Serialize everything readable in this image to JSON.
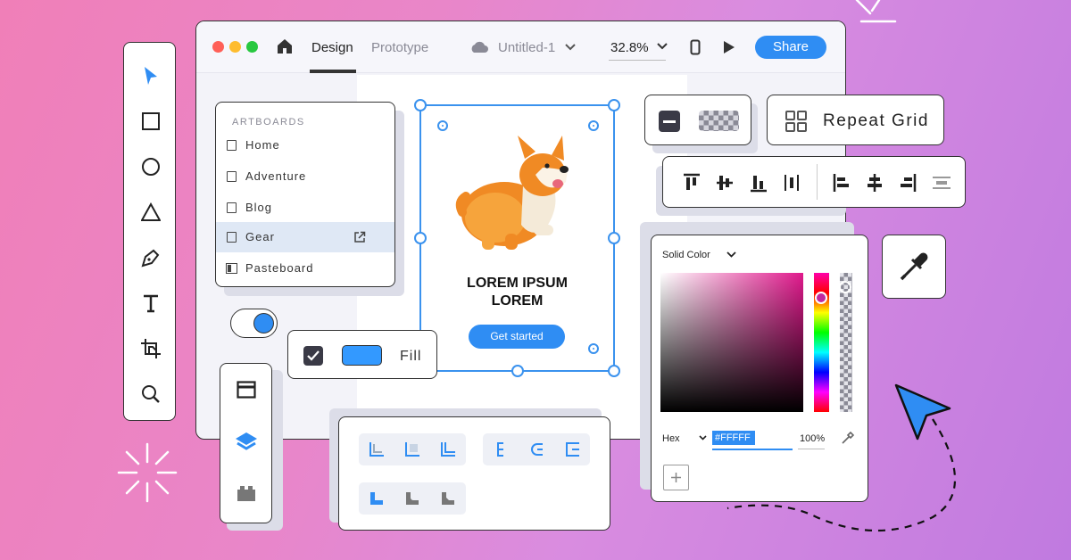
{
  "window": {
    "tabs": [
      {
        "label": "Design"
      },
      {
        "label": "Prototype"
      }
    ],
    "doc_title": "Untitled-1",
    "zoom": "32.8%",
    "share_label": "Share"
  },
  "artboards": {
    "heading": "ARTBOARDS",
    "items": [
      {
        "label": "Home"
      },
      {
        "label": "Adventure"
      },
      {
        "label": "Blog"
      },
      {
        "label": "Gear"
      },
      {
        "label": "Pasteboard"
      }
    ]
  },
  "artboard": {
    "headline_line1": "LOREM IPSUM",
    "headline_line2": "LOREM",
    "cta_label": "Get started"
  },
  "fill": {
    "label": "Fill",
    "checked": true
  },
  "repeat_grid": {
    "label": "Repeat Grid"
  },
  "color_picker": {
    "mode": "Solid Color",
    "format": "Hex",
    "hex_value": "#FFFFF",
    "opacity": "100%"
  },
  "colors": {
    "accent": "#2f8df3",
    "fill_swatch": "#3399ff"
  }
}
